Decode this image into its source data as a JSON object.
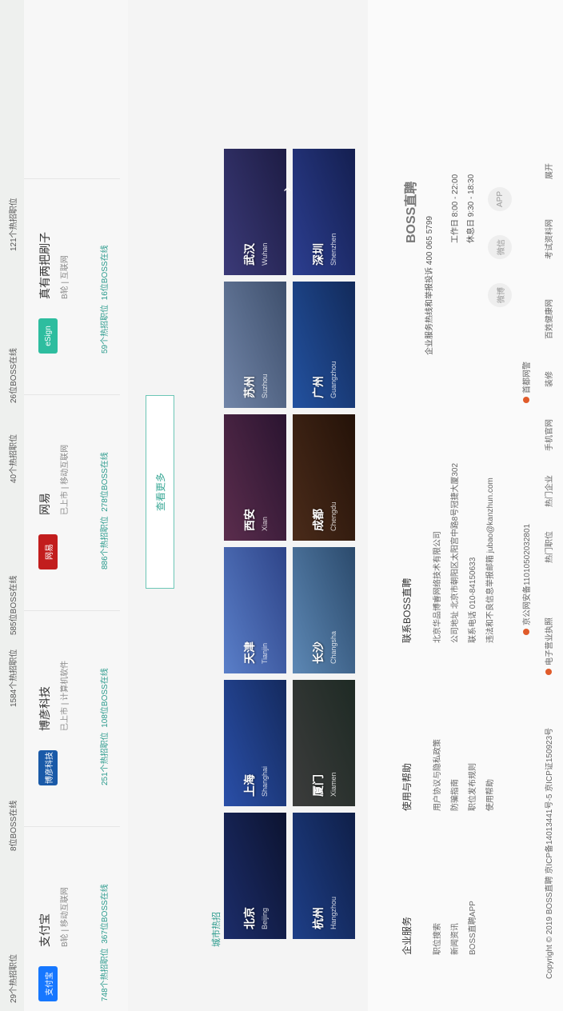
{
  "hot_row": [
    "29个热招职位",
    "8位BOSS在线",
    "1584个热招职位",
    "585位BOSS在线",
    "40个热招职位",
    "26位BOSS在线",
    "121个热招职位"
  ],
  "companies": [
    {
      "logo": "支付宝",
      "name": "支付宝",
      "meta": "B轮 | 移动互联网",
      "jobs": "748个热招职位",
      "boss": "367位BOSS在线",
      "accent": "#1677ff"
    },
    {
      "logo": "博彦科技",
      "name": "博彦科技",
      "meta": "已上市 | 计算机软件",
      "jobs": "251个热招职位",
      "boss": "108位BOSS在线",
      "accent": "#1a5aa8"
    },
    {
      "logo": "网易",
      "name": "网易",
      "meta": "已上市 | 移动互联网",
      "jobs": "886个热招职位",
      "boss": "278位BOSS在线",
      "accent": "#c21d1d"
    },
    {
      "logo": "eSign",
      "name": "真有两把刷子",
      "meta": "B轮 | 互联网",
      "jobs": "59个热招职位",
      "boss": "16位BOSS在线",
      "accent": "#2ebd9f"
    }
  ],
  "more_button": "查看更多",
  "city_section": {
    "title": "城市热招",
    "cities": [
      {
        "cn": "北京",
        "en": "Beijing",
        "color": "#1c2d6a"
      },
      {
        "cn": "上海",
        "en": "Shanghai",
        "color": "#2a4fa8"
      },
      {
        "cn": "天津",
        "en": "Tianjin",
        "color": "#5a7fc9"
      },
      {
        "cn": "西安",
        "en": "Xian",
        "color": "#5b2d4d"
      },
      {
        "cn": "苏州",
        "en": "Suzhou",
        "color": "#7185a8"
      },
      {
        "cn": "武汉",
        "en": "Wuhan",
        "color": "#3b3a78"
      },
      {
        "cn": "杭州",
        "en": "Hangzhou",
        "color": "#1e3f88"
      },
      {
        "cn": "厦门",
        "en": "Xiamen",
        "color": "#3c3c3c"
      },
      {
        "cn": "长沙",
        "en": "Changsha",
        "color": "#5d88b5"
      },
      {
        "cn": "成都",
        "en": "Chengdu",
        "color": "#4a2b1a"
      },
      {
        "cn": "广州",
        "en": "Guangzhou",
        "color": "#2352a0"
      },
      {
        "cn": "深圳",
        "en": "Shenzhen",
        "color": "#2c3e90"
      }
    ],
    "next_arrow": "›"
  },
  "footer": {
    "enterprise_title": "企业服务",
    "enterprise_items": [
      "职位搜索",
      "新闻资讯",
      "BOSS直聘APP"
    ],
    "help_title": "使用与帮助",
    "help_items": [
      "用户协议与隐私政策",
      "防骗指南",
      "职位发布规则",
      "使用帮助"
    ],
    "contact_title": "联系BOSS直聘",
    "contact_items": [
      "北京华品博睿网络技术有限公司",
      "公司地址 北京市朝阳区太阳宫中路8号冠捷大厦302",
      "联系电话 010-84150633",
      "违法和不良信息举报邮箱 jubao@kanzhun.com"
    ],
    "brand": "BOSS直聘",
    "hotline": "企业服务热线和举报投诉  400 065 5799",
    "workday": "工作日  8:00 - 22:00",
    "holiday": "休息日  9:30 - 18:30",
    "social": [
      "微博",
      "微信",
      "APP"
    ],
    "copyright": "Copyright © 2019 BOSS直聘   京ICP备14013441号-5   京ICP证150923号",
    "license": "电子营业执照",
    "police": "京公网安备11010502032801",
    "report": "首都网警",
    "links": [
      "热门职位",
      "热门企业",
      "手机官网",
      "装修",
      "百姓健康网",
      "考试资料网",
      "展开"
    ]
  }
}
